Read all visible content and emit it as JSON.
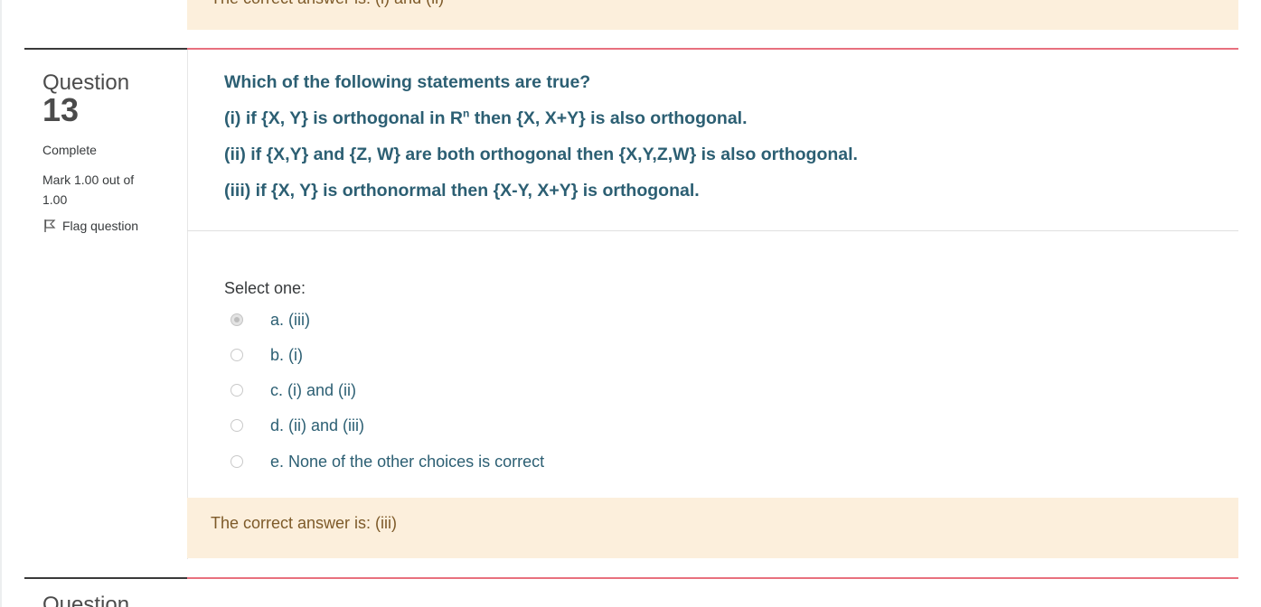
{
  "previous_question": {
    "feedback_text": "The correct answer is: (i) and (ii)"
  },
  "question": {
    "label": "Question",
    "number": "13",
    "state": "Complete",
    "grade": "Mark 1.00 out of 1.00",
    "flag_label": "Flag question",
    "text_lines": [
      "Which of the following statements are true?",
      "(ii) if {X,Y} and {Z, W} are both orthogonal then {X,Y,Z,W} is also orthogonal.",
      "(iii) if {X, Y} is orthonormal then {X-Y, X+Y} is orthogonal."
    ],
    "line_i": {
      "before": "(i) if {X, Y} is orthogonal in R",
      "sup": "n",
      "after": " then {X, X+Y} is also orthogonal."
    },
    "prompt": "Select one:",
    "options": [
      {
        "label": "a. (iii)",
        "selected": true
      },
      {
        "label": "b. (i)",
        "selected": false
      },
      {
        "label": "c. (i) and (ii)",
        "selected": false
      },
      {
        "label": "d. (ii) and (iii)",
        "selected": false
      },
      {
        "label": "e. None of the other choices is correct",
        "selected": false
      }
    ],
    "feedback_text": "The correct answer is: (iii)"
  },
  "next_question": {
    "label": "Question"
  },
  "colors": {
    "question_text": "#2c5f73",
    "feedback_bg": "#fcefdc",
    "separator": "#e8707e"
  }
}
